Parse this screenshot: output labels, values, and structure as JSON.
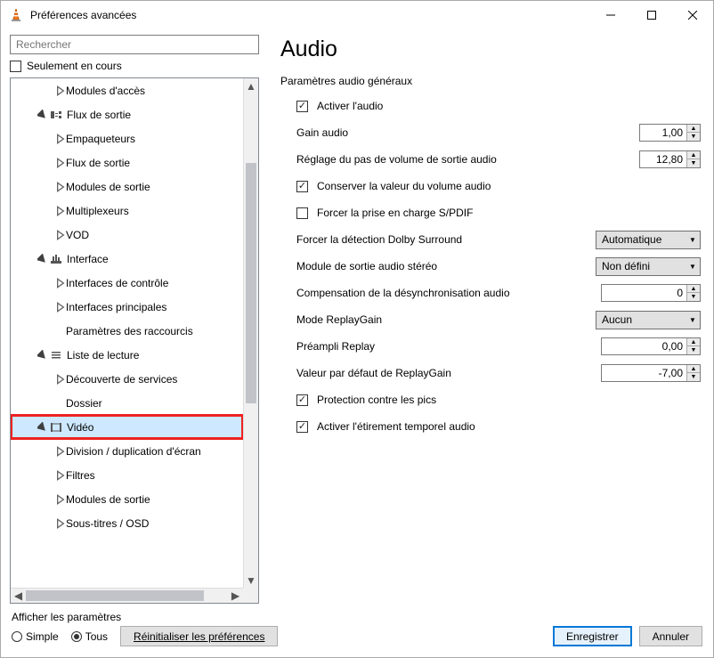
{
  "window": {
    "title": "Préférences avancées"
  },
  "search": {
    "placeholder": "Rechercher"
  },
  "only_loaded": "Seulement en cours",
  "tree": {
    "items": [
      {
        "label": "Modules d'accès",
        "indent": 2,
        "arrow": "closed"
      },
      {
        "label": "Flux de sortie",
        "indent": 1,
        "arrow": "open",
        "icon": "sout"
      },
      {
        "label": "Empaqueteurs",
        "indent": 2,
        "arrow": "closed"
      },
      {
        "label": "Flux de sortie",
        "indent": 2,
        "arrow": "closed"
      },
      {
        "label": "Modules de sortie",
        "indent": 2,
        "arrow": "closed"
      },
      {
        "label": "Multiplexeurs",
        "indent": 2,
        "arrow": "closed"
      },
      {
        "label": "VOD",
        "indent": 2,
        "arrow": "closed"
      },
      {
        "label": "Interface",
        "indent": 1,
        "arrow": "open",
        "icon": "intf"
      },
      {
        "label": "Interfaces de contrôle",
        "indent": 2,
        "arrow": "closed"
      },
      {
        "label": "Interfaces principales",
        "indent": 2,
        "arrow": "closed"
      },
      {
        "label": "Paramètres des raccourcis",
        "indent": 2,
        "arrow": "none"
      },
      {
        "label": "Liste de lecture",
        "indent": 1,
        "arrow": "open",
        "icon": "plist"
      },
      {
        "label": "Découverte de services",
        "indent": 2,
        "arrow": "closed"
      },
      {
        "label": "Dossier",
        "indent": 2,
        "arrow": "none"
      },
      {
        "label": "Vidéo",
        "indent": 1,
        "arrow": "open",
        "icon": "video",
        "highlight": true
      },
      {
        "label": "Division / duplication d'écran",
        "indent": 2,
        "arrow": "closed"
      },
      {
        "label": "Filtres",
        "indent": 2,
        "arrow": "closed"
      },
      {
        "label": "Modules de sortie",
        "indent": 2,
        "arrow": "closed"
      },
      {
        "label": "Sous-titres / OSD",
        "indent": 2,
        "arrow": "closed"
      }
    ]
  },
  "panel": {
    "title": "Audio",
    "section": "Paramètres audio généraux",
    "rows": [
      {
        "type": "check",
        "label": "Activer l'audio",
        "checked": true
      },
      {
        "type": "spin",
        "label": "Gain audio",
        "value": "1,00"
      },
      {
        "type": "spin",
        "label": "Réglage du pas de volume de sortie audio",
        "value": "12,80"
      },
      {
        "type": "check",
        "label": "Conserver la valeur du volume audio",
        "checked": true
      },
      {
        "type": "check",
        "label": "Forcer la prise en charge S/PDIF",
        "checked": false
      },
      {
        "type": "drop",
        "label": "Forcer la détection Dolby Surround",
        "value": "Automatique"
      },
      {
        "type": "drop",
        "label": "Module de sortie audio stéréo",
        "value": "Non défini",
        "wide": true
      },
      {
        "type": "spin",
        "label": "Compensation de la désynchronisation audio",
        "value": "0",
        "wide": true
      },
      {
        "type": "drop",
        "label": "Mode ReplayGain",
        "value": "Aucun",
        "wide": true
      },
      {
        "type": "spin",
        "label": "Préampli Replay",
        "value": "0,00",
        "wide": true
      },
      {
        "type": "spin",
        "label": "Valeur par défaut de ReplayGain",
        "value": "-7,00",
        "wide": true
      },
      {
        "type": "check",
        "label": "Protection contre les pics",
        "checked": true
      },
      {
        "type": "check",
        "label": "Activer l'étirement temporel audio",
        "checked": true
      }
    ]
  },
  "footer": {
    "show": "Afficher les paramètres",
    "simple": "Simple",
    "all": "Tous",
    "reset": "Réinitialiser les préférences",
    "save": "Enregistrer",
    "cancel": "Annuler"
  }
}
